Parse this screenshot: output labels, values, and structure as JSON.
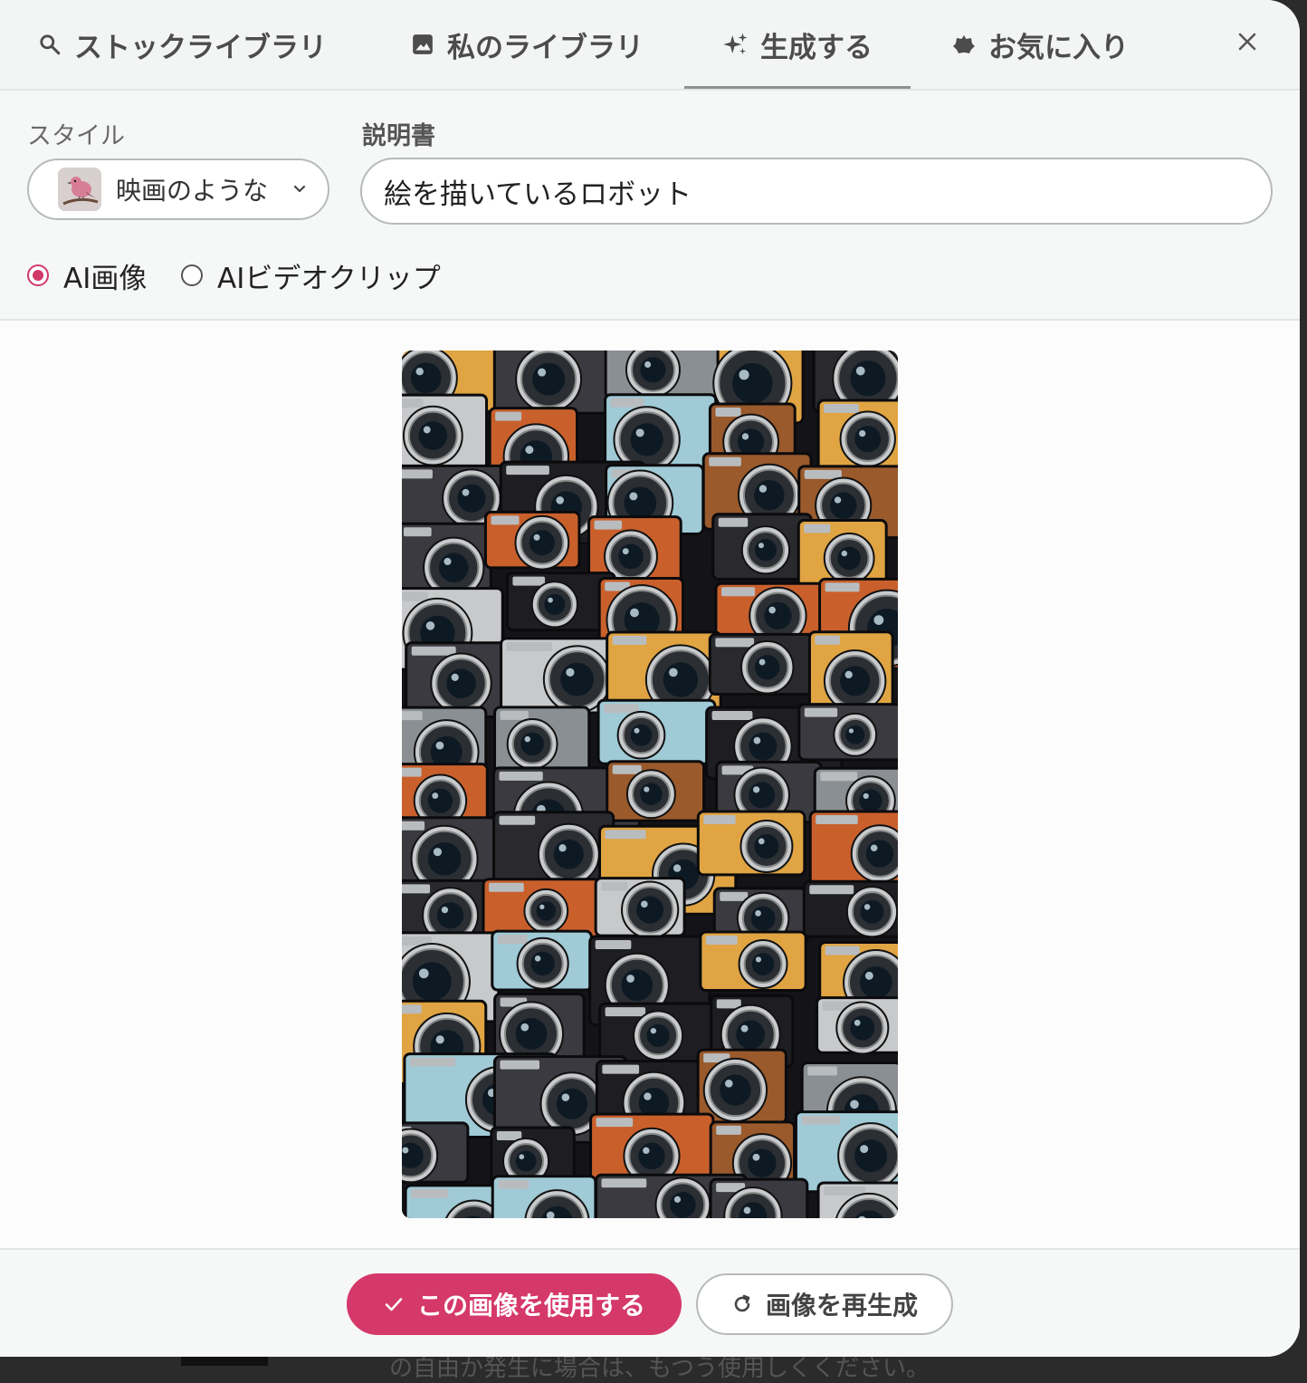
{
  "backdrop": {
    "text": "の自由か発生に場合は、もつう使用しくください。"
  },
  "tabs": [
    {
      "label": "ストックライブラリ",
      "icon": "search-icon",
      "active": false
    },
    {
      "label": "私のライブラリ",
      "icon": "image-icon",
      "active": false
    },
    {
      "label": "生成する",
      "icon": "sparkle-icon",
      "active": true
    },
    {
      "label": "お気に入り",
      "icon": "pentagon-star-icon",
      "active": false
    }
  ],
  "close_icon": "close-icon",
  "form": {
    "style_label": "スタイル",
    "style_value": "映画のような",
    "style_thumb_icon": "bird-thumbnail",
    "description_label": "説明書",
    "description_value": "絵を描いているロボット",
    "media_options": [
      {
        "label": "AI画像",
        "checked": true
      },
      {
        "label": "AIビデオクリップ",
        "checked": false
      }
    ]
  },
  "preview": {
    "image_subject": "collage of vintage cameras"
  },
  "footer": {
    "use_button_label": "この画像を使用する",
    "use_button_icon": "check-icon",
    "regenerate_button_label": "画像を再生成",
    "regenerate_button_icon": "refresh-icon"
  },
  "colors": {
    "accent": "#d5386a",
    "tab_bar": "#f3f5f4",
    "border": "#b6bbba"
  }
}
